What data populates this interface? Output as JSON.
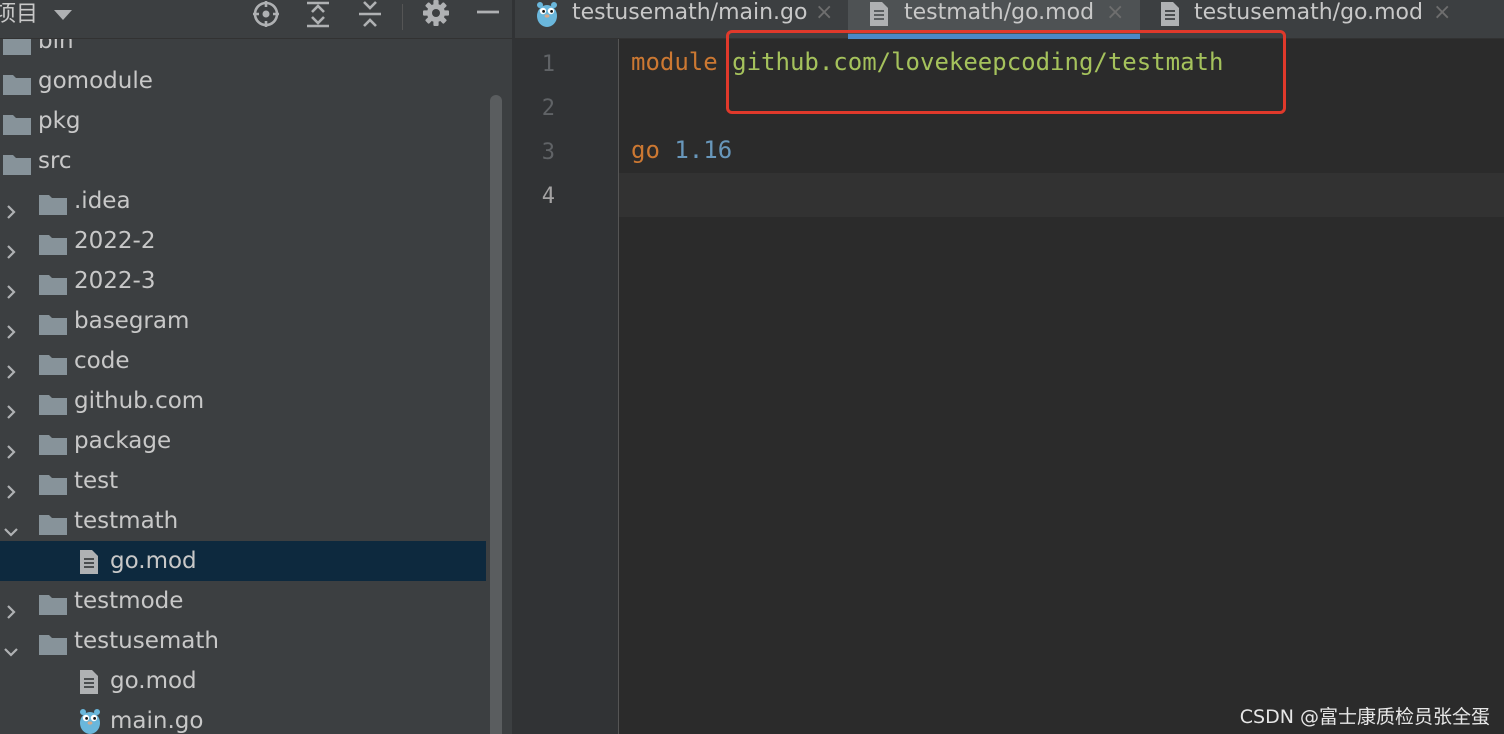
{
  "project_panel": {
    "title": "项目",
    "toolbar_icons": [
      "dropdown-icon",
      "locate-icon",
      "expand-all-icon",
      "collapse-all-icon",
      "gear-icon",
      "minimize-icon"
    ],
    "tree": [
      {
        "label": "bin",
        "kind": "folder",
        "depth": 0,
        "expandable": false
      },
      {
        "label": "gomodule",
        "kind": "folder",
        "depth": 0,
        "expandable": false
      },
      {
        "label": "pkg",
        "kind": "folder",
        "depth": 0,
        "expandable": false
      },
      {
        "label": "src",
        "kind": "folder",
        "depth": 0,
        "expandable": false
      },
      {
        "label": ".idea",
        "kind": "folder",
        "depth": 1,
        "expandable": true,
        "expanded": false
      },
      {
        "label": "2022-2",
        "kind": "folder",
        "depth": 1,
        "expandable": true,
        "expanded": false
      },
      {
        "label": "2022-3",
        "kind": "folder",
        "depth": 1,
        "expandable": true,
        "expanded": false
      },
      {
        "label": "basegram",
        "kind": "folder",
        "depth": 1,
        "expandable": true,
        "expanded": false
      },
      {
        "label": "code",
        "kind": "folder",
        "depth": 1,
        "expandable": true,
        "expanded": false
      },
      {
        "label": "github.com",
        "kind": "folder",
        "depth": 1,
        "expandable": true,
        "expanded": false
      },
      {
        "label": "package",
        "kind": "folder",
        "depth": 1,
        "expandable": true,
        "expanded": false
      },
      {
        "label": "test",
        "kind": "folder",
        "depth": 1,
        "expandable": true,
        "expanded": false
      },
      {
        "label": "testmath",
        "kind": "folder",
        "depth": 1,
        "expandable": true,
        "expanded": true
      },
      {
        "label": "go.mod",
        "kind": "modfile",
        "depth": 2,
        "expandable": false,
        "selected": true
      },
      {
        "label": "testmode",
        "kind": "folder",
        "depth": 1,
        "expandable": true,
        "expanded": false
      },
      {
        "label": "testusemath",
        "kind": "folder",
        "depth": 1,
        "expandable": true,
        "expanded": true
      },
      {
        "label": "go.mod",
        "kind": "modfile",
        "depth": 2,
        "expandable": false
      },
      {
        "label": "main.go",
        "kind": "gofile",
        "depth": 2,
        "expandable": false
      }
    ]
  },
  "tabs": [
    {
      "label": "testusemath/main.go",
      "icon": "gopher-icon",
      "active": false
    },
    {
      "label": "testmath/go.mod",
      "icon": "mod-file-icon",
      "active": true
    },
    {
      "label": "testusemath/go.mod",
      "icon": "mod-file-icon",
      "active": false
    }
  ],
  "tab_close_glyph": "×",
  "editor": {
    "lines": [
      {
        "number": "1",
        "tokens": [
          {
            "text": "module",
            "kind": "keyword"
          },
          {
            "text": " ",
            "kind": "plain"
          },
          {
            "text": "github.com/lovekeepcoding/testmath",
            "kind": "string"
          }
        ]
      },
      {
        "number": "2",
        "tokens": []
      },
      {
        "number": "3",
        "tokens": [
          {
            "text": "go",
            "kind": "keyword"
          },
          {
            "text": " ",
            "kind": "plain"
          },
          {
            "text": "1.16",
            "kind": "number"
          }
        ]
      },
      {
        "number": "4",
        "tokens": [],
        "current": true
      }
    ]
  },
  "colors": {
    "keyword": "#cc7832",
    "string": "#a5c25c",
    "number": "#6897bb",
    "annotation_box": "#e0392b",
    "selection": "#0d293e",
    "tab_underline": "#4a88c7"
  },
  "watermark": "CSDN @富士康质检员张全蛋"
}
